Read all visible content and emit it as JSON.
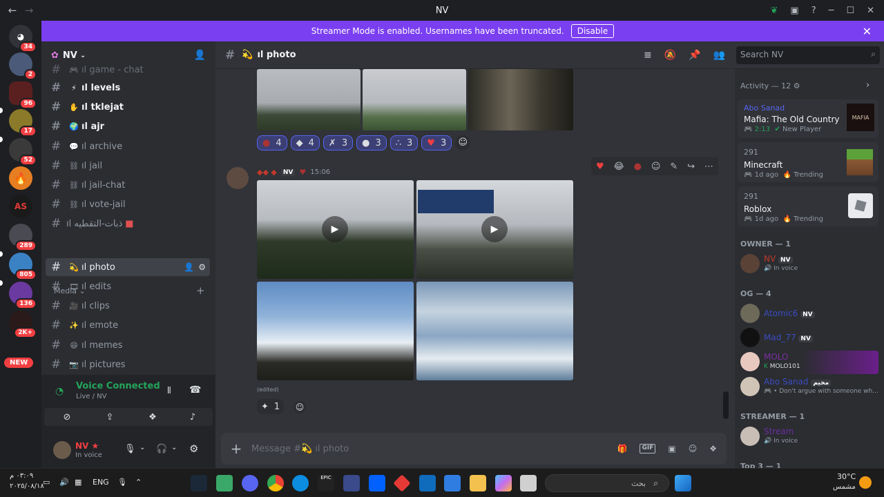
{
  "window": {
    "title": "NV",
    "back": "←",
    "forward": "→",
    "minimize": "─",
    "maximize": "☐",
    "close": "✕"
  },
  "banner": {
    "text": "Streamer Mode is enabled. Usernames have been truncated.",
    "button": "Disable"
  },
  "guilds": [
    {
      "badge": "34"
    },
    {
      "badge": "2"
    },
    {
      "badge": "96"
    },
    {
      "badge": "17"
    },
    {
      "badge": "52"
    },
    {
      "badge": ""
    },
    {
      "badge": ""
    },
    {
      "badge": "289"
    },
    {
      "badge": "805"
    },
    {
      "badge": "136"
    },
    {
      "badge": "2K+"
    },
    {
      "badge": "NEW"
    }
  ],
  "server": {
    "name": "NV"
  },
  "channels": {
    "partial": "ıl game - chat",
    "levels": "ıl levels",
    "tklejat": "ıl tklejat",
    "ajr": "ıl ajr",
    "archive": "ıl archive",
    "jail": "ıl jail",
    "jailchat": "ıl jail-chat",
    "votejail": "ıl vote-jail",
    "arabic": "ıl ذبات-التقطيه",
    "category": "Media",
    "photo": "ıl photo",
    "edits": "ıl edits",
    "clips": "ıl clips",
    "emote": "ıl emote",
    "memes": "ıl memes",
    "pictures": "ıl pictures"
  },
  "voice": {
    "title": "Voice Connected",
    "sub": "Live / NV"
  },
  "user": {
    "name": "NV ★",
    "status": "In voice"
  },
  "header": {
    "channel": "ıl photo"
  },
  "search": {
    "placeholder": "Search NV"
  },
  "reactions": [
    "4",
    "4",
    "3",
    "3",
    "3",
    "3"
  ],
  "message": {
    "tag": "NV",
    "time": "15:06",
    "edited": "(edited)",
    "reaction_count": "1"
  },
  "composer": {
    "placeholder": "Message #💫 ıl photo",
    "gif": "GIF"
  },
  "activity": {
    "header": "Activity — 12",
    "cards": [
      {
        "user": "Abo Sanad",
        "game": "Mafia: The Old Country",
        "time": "2:13",
        "meta": "New Player",
        "thumb": "MAFIA"
      },
      {
        "user": "291",
        "game": "Minecraft",
        "time": "1d ago",
        "meta": "Trending"
      },
      {
        "user": "291",
        "game": "Roblox",
        "time": "1d ago",
        "meta": "Trending"
      }
    ]
  },
  "groups": {
    "owner": "OWNER — 1",
    "og": "OG — 4",
    "streamer": "STREAMER — 1",
    "top": "Top 3 — 1"
  },
  "members": [
    {
      "name": "NV",
      "tag": "NV",
      "status": "In voice"
    },
    {
      "name": "Atomic6",
      "tag": "NV",
      "status": ""
    },
    {
      "name": "Mad_77",
      "tag": "NV",
      "status": ""
    },
    {
      "name": "MOLO",
      "tag": "",
      "status": "MOLO101"
    },
    {
      "name": "Abo Sanad",
      "tag": "مخيم",
      "status": "• Don't argue with someone wh..."
    },
    {
      "name": "Stream",
      "tag": "",
      "status": "In voice"
    }
  ],
  "taskbar": {
    "lang": "ENG",
    "time": "٠٣:٠٩ م",
    "date": "٢٠٢٥/٠٨/١٨",
    "search": "بحث",
    "weather": "30°C",
    "weather_sub": "مشمس"
  }
}
